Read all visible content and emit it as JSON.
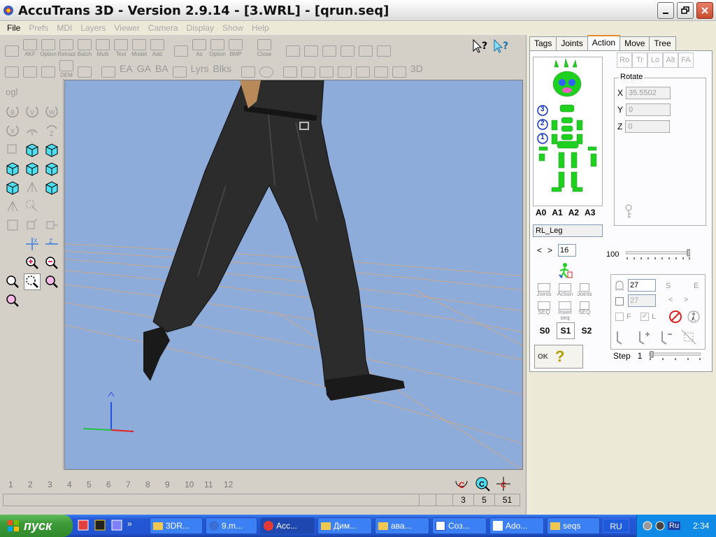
{
  "window": {
    "title": "AccuTrans 3D - Version 2.9.14 - [3.WRL] - [qrun.seq]"
  },
  "menu": [
    "File",
    "Prefs",
    "MDI",
    "Layers",
    "Viewer",
    "Camera",
    "Display",
    "Show",
    "Help"
  ],
  "toolbar": {
    "row1": [
      {
        "label": "",
        "icon": "open-icon"
      },
      {
        "label": "AKF",
        "icon": "folder-icon"
      },
      {
        "label": "Option",
        "icon": "folder-icon"
      },
      {
        "label": "Reload",
        "icon": "folder-icon"
      },
      {
        "label": "Batch",
        "icon": "folder-icon"
      },
      {
        "label": "Multi",
        "icon": "folder-icon"
      },
      {
        "label": "Text",
        "icon": "folder-icon"
      },
      {
        "label": "Model",
        "icon": "folder-icon"
      },
      {
        "label": "Add",
        "icon": "folder-icon"
      },
      {
        "label": "",
        "icon": "save-icon"
      },
      {
        "label": "As",
        "icon": "save-icon"
      },
      {
        "label": "Option",
        "icon": "save-icon"
      },
      {
        "label": "BMP",
        "icon": "save-icon"
      },
      {
        "label": "Close",
        "icon": "close-file-icon"
      }
    ],
    "row2_text": [
      "DEM",
      "EA",
      "GA",
      "BA",
      "Lyrs",
      "Blks",
      "3D"
    ]
  },
  "left_tools": {
    "ogl_label": "ogl"
  },
  "frames": {
    "numbers": [
      "1",
      "2",
      "3",
      "4",
      "5",
      "6",
      "7",
      "8",
      "9",
      "10",
      "11",
      "12"
    ],
    "status_values": [
      "3",
      "5",
      "51"
    ]
  },
  "right_panel": {
    "tabs": [
      {
        "label": "Tags",
        "active": false
      },
      {
        "label": "Joints",
        "active": false
      },
      {
        "label": "Action",
        "active": true
      },
      {
        "label": "Move",
        "active": false
      },
      {
        "label": "Tree",
        "active": false
      }
    ],
    "joint_markers": [
      "3",
      "2",
      "1"
    ],
    "a_labels": [
      "A0",
      "A1",
      "A2",
      "A3"
    ],
    "joint_name": "RL_Leg",
    "nav_prev": "<",
    "nav_next": ">",
    "frame_value": "16",
    "icon_labels": {
      "open_joints": "Joints",
      "open_action": "Action",
      "save_joints": "Joints",
      "open_seq": "SEQ",
      "insert_seq": "Insert seq",
      "save_seq": "SEQ"
    },
    "s_labels": [
      "S0",
      "S1",
      "S2"
    ],
    "s_selected": "S1",
    "ok_label": "OK",
    "help_label": "?",
    "rot_tabs": [
      "Ro",
      "Tr",
      "Lo",
      "Alt",
      "FA"
    ],
    "rotate": {
      "title": "Rotate",
      "x_label": "X",
      "x_value": "35.5502",
      "y_label": "Y",
      "y_value": "0",
      "z_label": "Z",
      "z_value": "0"
    },
    "slider_value": "100",
    "loop": {
      "start_value": "27",
      "end_value": "27",
      "s_label": "S",
      "e_label": "E",
      "f_label": "F",
      "l_label": "L",
      "prev": "<",
      "next": ">"
    },
    "step_label": "Step",
    "step_value": "1"
  },
  "taskbar": {
    "start_label": "пуск",
    "tasks": [
      {
        "label": "3DR...",
        "icon": "folder-icon",
        "active": false
      },
      {
        "label": "9.m...",
        "icon": "browser-icon",
        "active": false
      },
      {
        "label": "Acc...",
        "icon": "accutrans-icon",
        "active": true
      },
      {
        "label": "Дим...",
        "icon": "folder-icon",
        "active": false
      },
      {
        "label": "ава...",
        "icon": "folder-icon",
        "active": false
      },
      {
        "label": "Соз...",
        "icon": "word-icon",
        "active": false
      },
      {
        "label": "Ado...",
        "icon": "pen-icon",
        "active": false
      },
      {
        "label": "seqs",
        "icon": "folder-icon",
        "active": false
      }
    ],
    "language": "RU",
    "tray_lang": "Ru",
    "clock": "2:34"
  },
  "colors": {
    "viewport_bg": "#8eacd9",
    "skeleton_green": "#1fd11f",
    "tab_accent": "#e68b2c",
    "taskbar": "#2153d0"
  }
}
